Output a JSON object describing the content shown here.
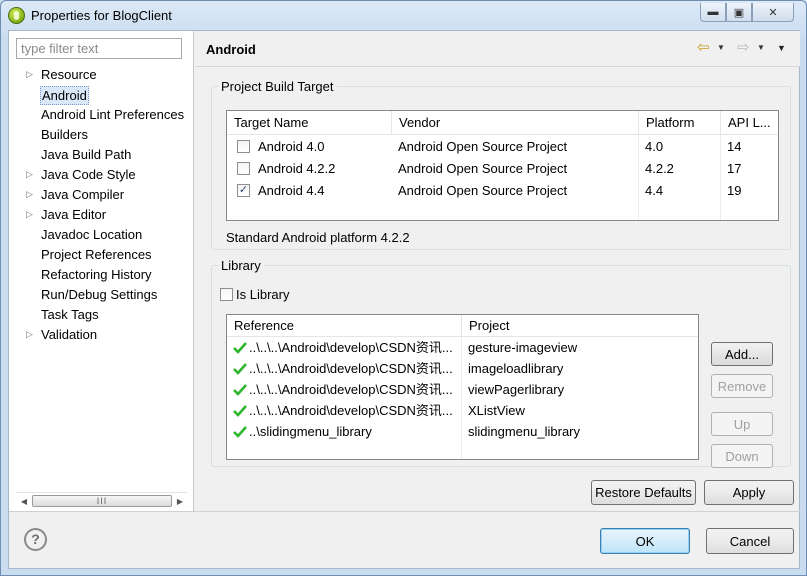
{
  "window": {
    "title": "Properties for BlogClient",
    "controls": [
      "minimize",
      "maximize",
      "close"
    ]
  },
  "filter": {
    "placeholder": "type filter text"
  },
  "tree": {
    "selected": "Android",
    "items": [
      {
        "label": "Resource",
        "expandable": true
      },
      {
        "label": "Android",
        "expandable": false
      },
      {
        "label": "Android Lint Preferences",
        "expandable": false
      },
      {
        "label": "Builders",
        "expandable": false
      },
      {
        "label": "Java Build Path",
        "expandable": false
      },
      {
        "label": "Java Code Style",
        "expandable": true
      },
      {
        "label": "Java Compiler",
        "expandable": true
      },
      {
        "label": "Java Editor",
        "expandable": true
      },
      {
        "label": "Javadoc Location",
        "expandable": false
      },
      {
        "label": "Project References",
        "expandable": false
      },
      {
        "label": "Refactoring History",
        "expandable": false
      },
      {
        "label": "Run/Debug Settings",
        "expandable": false
      },
      {
        "label": "Task Tags",
        "expandable": false
      },
      {
        "label": "Validation",
        "expandable": true
      }
    ],
    "scroll_thumb": "III"
  },
  "page": {
    "title": "Android"
  },
  "build_target": {
    "group_title": "Project Build Target",
    "columns": [
      "Target Name",
      "Vendor",
      "Platform",
      "API L..."
    ],
    "rows": [
      {
        "name": "Android 4.0",
        "vendor": "Android Open Source Project",
        "platform": "4.0",
        "api": "14",
        "checked": false
      },
      {
        "name": "Android 4.2.2",
        "vendor": "Android Open Source Project",
        "platform": "4.2.2",
        "api": "17",
        "checked": false
      },
      {
        "name": "Android 4.4",
        "vendor": "Android Open Source Project",
        "platform": "4.4",
        "api": "19",
        "checked": true
      }
    ],
    "status": "Standard Android platform 4.2.2"
  },
  "library": {
    "group_title": "Library",
    "is_library_label": "Is Library",
    "is_library_checked": false,
    "columns": [
      "Reference",
      "Project"
    ],
    "rows": [
      {
        "reference": "..\\..\\..\\Android\\develop\\CSDN资讯...",
        "project": "gesture-imageview"
      },
      {
        "reference": "..\\..\\..\\Android\\develop\\CSDN资讯...",
        "project": "imageloadlibrary"
      },
      {
        "reference": "..\\..\\..\\Android\\develop\\CSDN资讯...",
        "project": "viewPagerlibrary"
      },
      {
        "reference": "..\\..\\..\\Android\\develop\\CSDN资讯...",
        "project": "XListView"
      },
      {
        "reference": "..\\slidingmenu_library",
        "project": "slidingmenu_library"
      }
    ],
    "buttons": {
      "add": "Add...",
      "remove": "Remove",
      "up": "Up",
      "down": "Down"
    }
  },
  "buttons": {
    "restore_defaults": "Restore Defaults",
    "apply": "Apply",
    "ok": "OK",
    "cancel": "Cancel",
    "help": "?"
  },
  "colors": {
    "check_green": "#2db52d",
    "selection": "#d9e7f8",
    "title_bar": "#c9dcf0"
  }
}
